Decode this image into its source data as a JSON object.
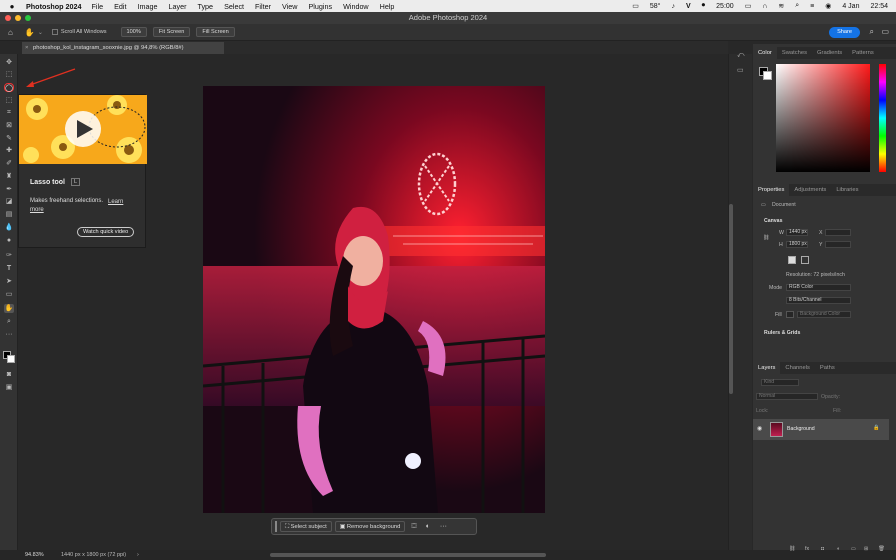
{
  "mac_menu": {
    "app_name": "Photoshop 2024",
    "items": [
      "File",
      "Edit",
      "Image",
      "Layer",
      "Type",
      "Select",
      "Filter",
      "View",
      "Plugins",
      "Window",
      "Help"
    ],
    "status": {
      "temp": "58°",
      "time": "25:00",
      "date": "4 Jan",
      "clock": "22:54"
    }
  },
  "window": {
    "title": "Adobe Photoshop 2024"
  },
  "options_bar": {
    "scroll_all": "Scroll All Windows",
    "zoom": "100%",
    "fit_screen": "Fit Screen",
    "fill_screen": "Fill Screen",
    "share": "Share"
  },
  "document_tab": {
    "label": "photoshop_kol_instagram_sooxnie.jpg @ 94,8% (RGB/8#)"
  },
  "tooltip": {
    "title": "Lasso tool",
    "shortcut": "L",
    "description": "Makes freehand selections.",
    "learn_more": "Learn more",
    "video_button": "Watch quick video"
  },
  "context_bar": {
    "select_subject": "Select subject",
    "remove_background": "Remove background"
  },
  "status_bar": {
    "zoom": "94.83%",
    "doc_info": "1440 px x 1800 px (72 ppi)"
  },
  "color_panel": {
    "tabs": [
      "Color",
      "Swatches",
      "Gradients",
      "Patterns"
    ],
    "hue": "#ff1a1a"
  },
  "properties_panel": {
    "tabs": [
      "Properties",
      "Adjustments",
      "Libraries"
    ],
    "doc_label": "Document",
    "canvas_section": "Canvas",
    "w_label": "W",
    "w_value": "1440 px",
    "h_label": "H",
    "h_value": "1800 px",
    "x_label": "X",
    "y_label": "Y",
    "resolution": "Resolution: 72 pixels/inch",
    "mode_label": "Mode",
    "mode_value": "RGB Color",
    "depth_value": "8 Bits/Channel",
    "fill_label": "Fill",
    "fill_value": "Background Color",
    "rulers_section": "Rulers & Grids"
  },
  "layers_panel": {
    "tabs": [
      "Layers",
      "Channels",
      "Paths"
    ],
    "search_placeholder": "Kind",
    "blend_mode": "Normal",
    "opacity_label": "Opacity:",
    "lock_label": "Lock:",
    "fill_label": "Fill:",
    "layers": [
      {
        "name": "Background",
        "visible": true,
        "locked": true
      }
    ]
  }
}
